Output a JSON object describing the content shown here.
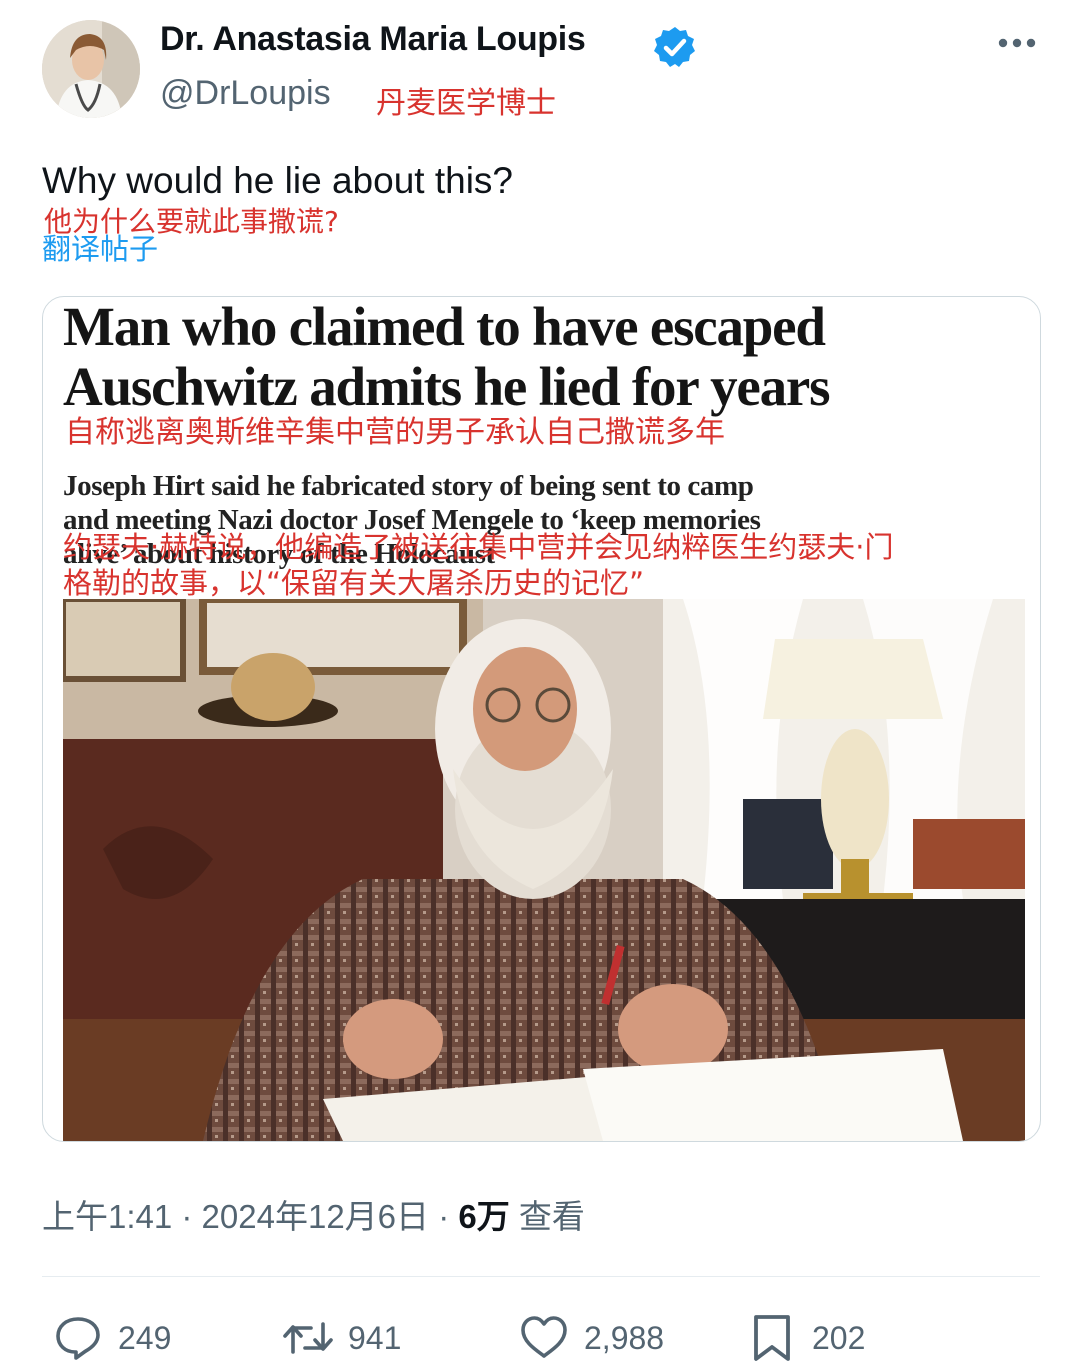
{
  "author": {
    "name": "Dr. Anastasia Maria Loupis",
    "handle": "@DrLoupis",
    "handle_translation": "丹麦医学博士"
  },
  "tweet": {
    "text": "Why would he lie about this?",
    "text_translation": "他为什么要就此事撒谎?",
    "translate_link": "翻译帖子"
  },
  "media": {
    "headline_line1": "Man who claimed to have escaped",
    "headline_line2": "Auschwitz admits he lied for years",
    "headline_translation": "自称逃离奥斯维辛集中营的男子承认自己撒谎多年",
    "standfirst_line1": "Joseph Hirt said he fabricated story of being sent to camp",
    "standfirst_line2": "and meeting Nazi doctor Josef Mengele to ‘keep memories",
    "standfirst_line3": "alive’ about history of the Holocaust",
    "standfirst_translation_line1": "约瑟夫·赫特说，他编造了被送往集中营并会见纳粹医生约瑟夫·门",
    "standfirst_translation_line2": "格勒的故事，以“保留有关大屠杀历史的记忆”"
  },
  "meta": {
    "time_date": "上午1:41 · 2024年12月6日 · ",
    "views_count": "6万",
    "views_label": " 查看"
  },
  "actions": {
    "replies": "249",
    "reposts": "941",
    "likes": "2,988",
    "bookmarks": "202"
  },
  "colors": {
    "accent": "#1d9bf0",
    "translation_red": "#d8332e",
    "secondary_text": "#536471"
  },
  "icons": [
    "verified-badge-icon",
    "more-icon",
    "reply-icon",
    "repost-icon",
    "like-icon",
    "bookmark-icon"
  ]
}
